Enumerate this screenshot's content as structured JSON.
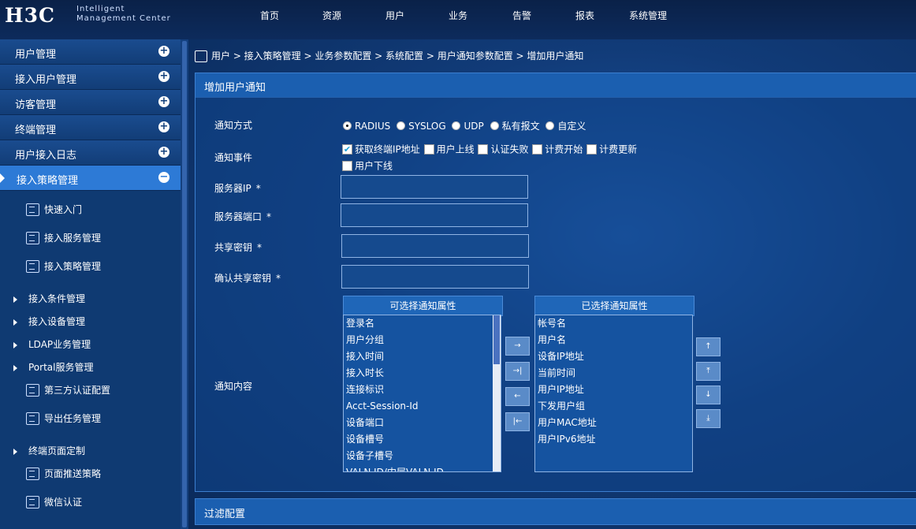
{
  "app": {
    "logo": "H3C",
    "logo_line1": "Intelligent",
    "logo_line2": "Management Center",
    "nav": [
      "首页",
      "资源",
      "用户",
      "业务",
      "告警",
      "报表",
      "系统管理"
    ]
  },
  "sidebar": {
    "groups": [
      "用户管理",
      "接入用户管理",
      "访客管理",
      "终端管理",
      "用户接入日志",
      "接入策略管理"
    ],
    "items": [
      {
        "label": "快速入门",
        "kind": "icon"
      },
      {
        "label": "接入服务管理",
        "kind": "icon"
      },
      {
        "label": "接入策略管理",
        "kind": "icon"
      },
      {
        "label": "接入条件管理",
        "kind": "tree"
      },
      {
        "label": "接入设备管理",
        "kind": "tree"
      },
      {
        "label": "LDAP业务管理",
        "kind": "tree"
      },
      {
        "label": "Portal服务管理",
        "kind": "tree"
      },
      {
        "label": "第三方认证配置",
        "kind": "icon"
      },
      {
        "label": "导出任务管理",
        "kind": "icon"
      },
      {
        "label": "终端页面定制",
        "kind": "tree"
      },
      {
        "label": "页面推送策略",
        "kind": "icon"
      },
      {
        "label": "微信认证",
        "kind": "icon"
      }
    ]
  },
  "breadcrumb": "用户 > 接入策略管理 > 业务参数配置 > 系统配置 > 用户通知参数配置 > 增加用户通知",
  "panel": {
    "title": "增加用户通知",
    "notify_method_label": "通知方式",
    "notify_methods": [
      "RADIUS",
      "SYSLOG",
      "UDP",
      "私有报文",
      "自定义"
    ],
    "notify_method_selected": "RADIUS",
    "notify_event_label": "通知事件",
    "notify_events": [
      {
        "label": "获取终端IP地址",
        "checked": true
      },
      {
        "label": "用户上线",
        "checked": false
      },
      {
        "label": "认证失败",
        "checked": false
      },
      {
        "label": "计费开始",
        "checked": false
      },
      {
        "label": "计费更新",
        "checked": false
      },
      {
        "label": "用户下线",
        "checked": false
      }
    ],
    "server_ip_label": "服务器IP",
    "server_port_label": "服务器端口",
    "shared_key_label": "共享密钥",
    "confirm_key_label": "确认共享密钥",
    "required_mark": "*",
    "server_ip_value": "",
    "server_port_value": "",
    "shared_key_value": "",
    "confirm_key_value": "",
    "notify_content_label": "通知内容",
    "available_title": "可选择通知属性",
    "available": [
      "登录名",
      "用户分组",
      "接入时间",
      "接入时长",
      "连接标识",
      "Acct-Session-Id",
      "设备端口",
      "设备槽号",
      "设备子槽号",
      "VALN ID/内层VALN ID"
    ],
    "selected_title": "已选择通知属性",
    "selected": [
      "帐号名",
      "用户名",
      "设备IP地址",
      "当前时间",
      "用户IP地址",
      "下发用户组",
      "用户MAC地址",
      "用户IPv6地址"
    ],
    "move_buttons": [
      "→",
      "→|",
      "←",
      "|←"
    ],
    "order_buttons": [
      "↑",
      "⤒",
      "↓",
      "⤓"
    ]
  },
  "filter_panel_title": "过滤配置"
}
